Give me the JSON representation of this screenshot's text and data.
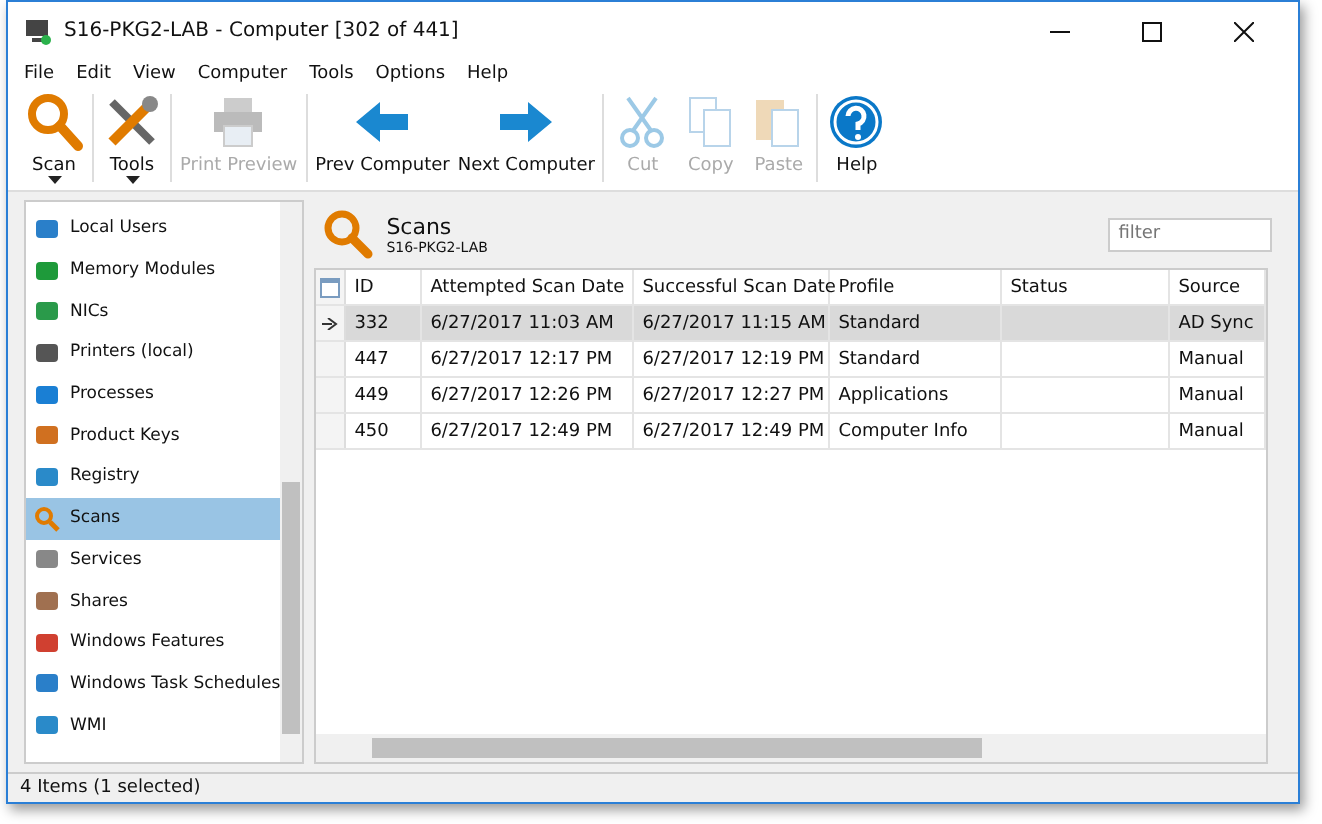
{
  "window": {
    "title": "S16-PKG2-LAB - Computer [302 of 441]"
  },
  "menu": [
    "File",
    "Edit",
    "View",
    "Computer",
    "Tools",
    "Options",
    "Help"
  ],
  "toolbar": [
    {
      "label": "Scan",
      "disabled": false,
      "dropdown": true
    },
    {
      "label": "Tools",
      "disabled": false,
      "dropdown": true
    },
    {
      "label": "Print Preview",
      "disabled": true,
      "dropdown": false
    },
    {
      "label": "Prev Computer",
      "disabled": false,
      "dropdown": false
    },
    {
      "label": "Next Computer",
      "disabled": false,
      "dropdown": false
    },
    {
      "label": "Cut",
      "disabled": true,
      "dropdown": false
    },
    {
      "label": "Copy",
      "disabled": true,
      "dropdown": false
    },
    {
      "label": "Paste",
      "disabled": true,
      "dropdown": false
    },
    {
      "label": "Help",
      "disabled": false,
      "dropdown": false
    }
  ],
  "sidebar": {
    "items": [
      {
        "label": "Local Users",
        "selected": false
      },
      {
        "label": "Memory Modules",
        "selected": false
      },
      {
        "label": "NICs",
        "selected": false
      },
      {
        "label": "Printers (local)",
        "selected": false
      },
      {
        "label": "Processes",
        "selected": false
      },
      {
        "label": "Product Keys",
        "selected": false
      },
      {
        "label": "Registry",
        "selected": false
      },
      {
        "label": "Scans",
        "selected": true
      },
      {
        "label": "Services",
        "selected": false
      },
      {
        "label": "Shares",
        "selected": false
      },
      {
        "label": "Windows Features",
        "selected": false
      },
      {
        "label": "Windows Task Schedules",
        "selected": false
      },
      {
        "label": "WMI",
        "selected": false
      }
    ]
  },
  "panel": {
    "title": "Scans",
    "subtitle": "S16-PKG2-LAB",
    "filter": {
      "placeholder": "filter"
    }
  },
  "table": {
    "columns": [
      "ID",
      "Attempted Scan Date",
      "Successful Scan Date",
      "Profile",
      "Status",
      "Source"
    ],
    "rows": [
      {
        "cells": [
          "332",
          "6/27/2017 11:03 AM",
          "6/27/2017 11:15 AM",
          "Standard",
          "",
          "AD Sync"
        ],
        "selected": true
      },
      {
        "cells": [
          "447",
          "6/27/2017 12:17 PM",
          "6/27/2017 12:19 PM",
          "Standard",
          "",
          "Manual"
        ],
        "selected": false
      },
      {
        "cells": [
          "449",
          "6/27/2017 12:26 PM",
          "6/27/2017 12:27 PM",
          "Applications",
          "",
          "Manual"
        ],
        "selected": false
      },
      {
        "cells": [
          "450",
          "6/27/2017 12:49 PM",
          "6/27/2017 12:49 PM",
          "Computer Info",
          "",
          "Manual"
        ],
        "selected": false
      }
    ]
  },
  "status_bar": "4 Items (1 selected)"
}
